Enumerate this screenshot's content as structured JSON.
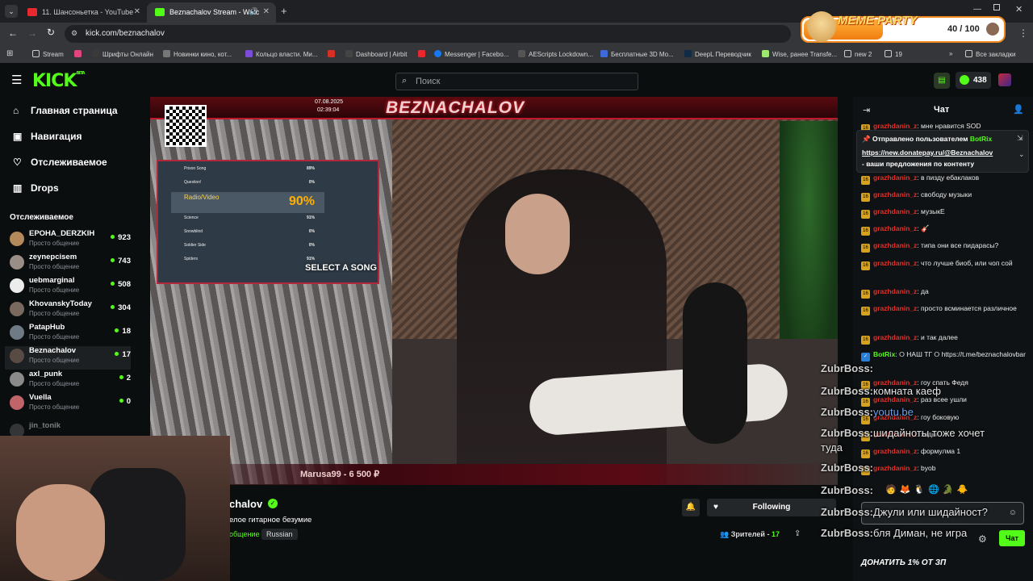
{
  "browser": {
    "tabs": [
      {
        "title": "11. Шансоньетка - YouTube",
        "active": false
      },
      {
        "title": "Beznachalov Stream - Watc",
        "active": true
      }
    ],
    "url": "kick.com/beznachalov",
    "bookmarks": [
      "Stream",
      "Шрифты Онлайн",
      "Новинки кино, кот...",
      "Кольцо власти. Ми...",
      "Dashboard | Airbit",
      "Messenger | Facebo...",
      "AEScripts Lockdown...",
      "Бесплатные 3D Mo...",
      "DeepL Переводчик",
      "Wise, ранее Transfe...",
      "new 2",
      "19",
      "Все закладки"
    ]
  },
  "overlay_widget": {
    "title": "MEME PARTY",
    "progress": "40 / 100",
    "progress_value": 0.4
  },
  "header": {
    "logo": "KICK",
    "logo_sup": "BETA",
    "search_placeholder": "Поиск",
    "coins": "438"
  },
  "sidebar": {
    "nav": [
      "Главная страница",
      "Навигация",
      "Отслеживаемое",
      "Drops"
    ],
    "following_title": "Отслеживаемое",
    "channels": [
      {
        "name": "EPOHA_DERZKIH",
        "category": "Просто общение",
        "viewers": "923",
        "color": "#b58a5a"
      },
      {
        "name": "zeynepcisem",
        "category": "Просто общение",
        "viewers": "743",
        "color": "#9a8f86"
      },
      {
        "name": "uebmarginal",
        "category": "Просто общение",
        "viewers": "508",
        "color": "#ececec"
      },
      {
        "name": "KhovanskyToday",
        "category": "Просто общение",
        "viewers": "304",
        "color": "#7a6a5e"
      },
      {
        "name": "PatapHub",
        "category": "Просто общение",
        "viewers": "18",
        "color": "#6e7a84"
      },
      {
        "name": "Beznachalov",
        "category": "Просто общение",
        "viewers": "17",
        "color": "#5a4a44"
      },
      {
        "name": "axl_punk",
        "category": "Просто общение",
        "viewers": "2",
        "color": "#8a8a8a"
      },
      {
        "name": "Vuella",
        "category": "Просто общение",
        "viewers": "0",
        "color": "#c0646a"
      },
      {
        "name": "jin_tonik",
        "category": "",
        "viewers": "",
        "color": "#666"
      }
    ]
  },
  "stream": {
    "overlay_top_date": "07.08.2025",
    "overlay_top_time": "02:39:04",
    "overlay_banner": "BEZNACHALOV",
    "game_menu": {
      "items": [
        {
          "name": "Prison Song",
          "score": "89%"
        },
        {
          "name": "Question!",
          "score": "0%"
        },
        {
          "name": "Radio/Video",
          "score": "90%"
        },
        {
          "name": "Science",
          "score": "91%"
        },
        {
          "name": "Snowblind",
          "score": "0%"
        },
        {
          "name": "Soldier Side",
          "score": "0%"
        },
        {
          "name": "Spiders",
          "score": "91%"
        }
      ],
      "select": "SELECT A SONG"
    },
    "donation_ticker": "Marusa99 - 6 500 ₽"
  },
  "info": {
    "channel_name": "chalov",
    "title": "елое гитарное безумие",
    "category": "общение",
    "tag": "Russian",
    "follow_label": "Following",
    "viewers_label": "Зрителей -",
    "viewers_count": "17"
  },
  "chat": {
    "title": "Чат",
    "pinned_by": "Отправлено пользователем",
    "pinned_user": "BotRix",
    "pinned_link": "https://new.donatepay.ru/@Beznachalov",
    "pinned_text": "- ваши предложения по контенту",
    "messages": [
      {
        "user": "grazhdanin_z",
        "text": "мне нравится SOD"
      },
      {
        "user": "grazhdanin_z",
        "text": "в пизду ебаклаков"
      },
      {
        "user": "grazhdanin_z",
        "text": "свободу музыки"
      },
      {
        "user": "grazhdanin_z",
        "text": "музыкЕ"
      },
      {
        "user": "grazhdanin_z",
        "text": "🎸"
      },
      {
        "user": "grazhdanin_z",
        "text": "типа они все пидарасы?"
      },
      {
        "user": "grazhdanin_z",
        "text": "что лучше биоб, или чоп сой"
      },
      {
        "user": "grazhdanin_z",
        "text": "да"
      },
      {
        "user": "grazhdanin_z",
        "text": "просто всминается различное"
      },
      {
        "user": "grazhdanin_z",
        "text": "и так далее"
      },
      {
        "user": "BotRix",
        "text": "⭘ НАШ ТГ ⭘ https://t.me/beznachalovbar"
      },
      {
        "user": "grazhdanin_z",
        "text": "гоу спать Федя"
      },
      {
        "user": "grazhdanin_z",
        "text": "раз всее ушли"
      },
      {
        "user": "grazhdanin_z",
        "text": "гоу боковую"
      },
      {
        "user": "grazhdanin_z",
        "text": "ходы"
      },
      {
        "user": "grazhdanin_z",
        "text": "формулма 1"
      },
      {
        "user": "grazhdanin_z",
        "text": "byob"
      }
    ],
    "send_label": "Чат",
    "donate_banner": "ДОНАТИТЬ 1% ОТ ЗП"
  },
  "overlay_chat": [
    {
      "user": "ZubrBoss:",
      "text": ""
    },
    {
      "user": "ZubrBoss:",
      "text": "комната каеф"
    },
    {
      "user": "ZubrBoss:",
      "text": "youtu.be"
    },
    {
      "user": "ZubrBoss:",
      "text": "шидайноты тоже хочет"
    },
    {
      "user": "",
      "text": "туда"
    },
    {
      "user": "ZubrBoss:",
      "text": ""
    },
    {
      "user": "ZubrBoss:",
      "text": ""
    },
    {
      "user": "ZubrBoss:",
      "text": "Джули или шидайност?"
    },
    {
      "user": "ZubrBoss:",
      "text": "бля Диман, не игра"
    }
  ],
  "colors": {
    "kick_green": "#53fc18",
    "bg": "#0b0e0f",
    "chat_bg": "#0f1214",
    "user_red": "#e0312b",
    "badge_gold": "#d6a21e"
  }
}
